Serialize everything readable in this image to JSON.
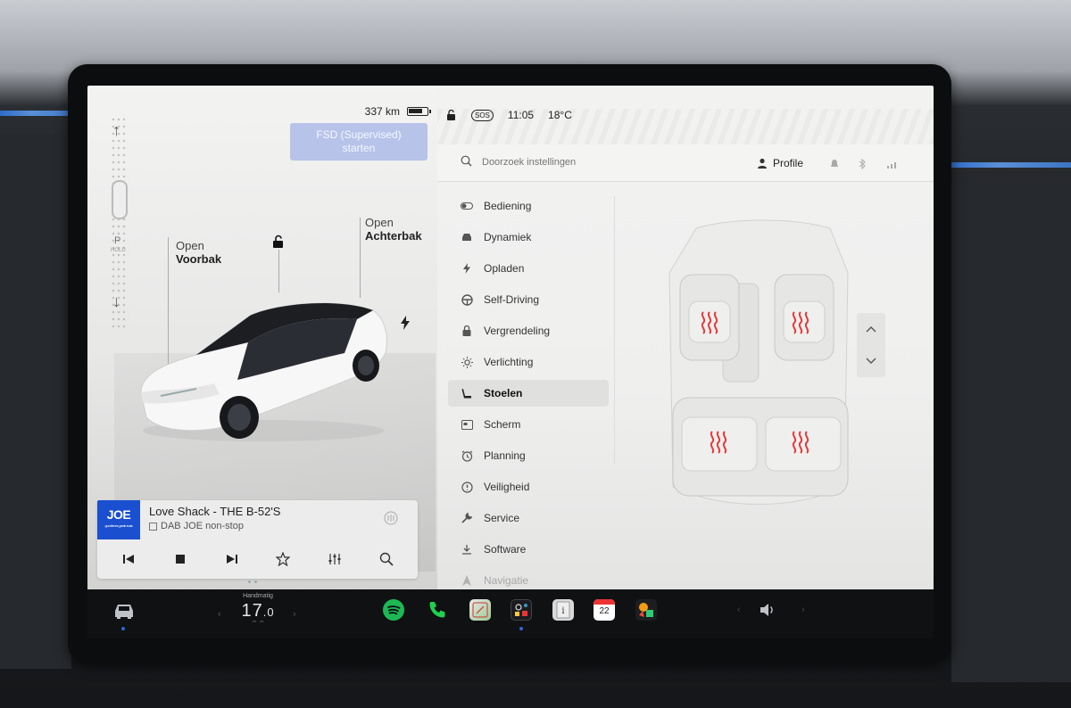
{
  "status_left": {
    "range": "337 km"
  },
  "fsd_button": {
    "line1": "FSD (Supervised)",
    "line2": "starten"
  },
  "gear": {
    "park": "P",
    "hold": "HOLD"
  },
  "car_labels": {
    "front_trunk": {
      "top": "Open",
      "bottom": "Voorbak"
    },
    "rear_trunk": {
      "top": "Open",
      "bottom": "Achterbak"
    }
  },
  "media": {
    "station_logo": "JOE",
    "station_tagline": "good times, great music",
    "title": "Love Shack - THE B-52'S",
    "subtitle": "DAB JOE non-stop"
  },
  "status_right": {
    "time": "11:05",
    "temp": "18°C",
    "sos": "SOS"
  },
  "search": {
    "placeholder": "Doorzoek instellingen"
  },
  "profile": {
    "label": "Profile"
  },
  "menu": {
    "items": [
      {
        "label": "Bediening",
        "icon": "toggle-icon"
      },
      {
        "label": "Dynamiek",
        "icon": "car-icon"
      },
      {
        "label": "Opladen",
        "icon": "bolt-icon"
      },
      {
        "label": "Self-Driving",
        "icon": "steering-wheel-icon"
      },
      {
        "label": "Vergrendeling",
        "icon": "lock-icon"
      },
      {
        "label": "Verlichting",
        "icon": "light-icon"
      },
      {
        "label": "Stoelen",
        "icon": "seat-icon",
        "active": true
      },
      {
        "label": "Scherm",
        "icon": "display-icon"
      },
      {
        "label": "Planning",
        "icon": "alarm-icon"
      },
      {
        "label": "Veiligheid",
        "icon": "shield-icon"
      },
      {
        "label": "Service",
        "icon": "wrench-icon"
      },
      {
        "label": "Software",
        "icon": "download-icon"
      },
      {
        "label": "Navigatie",
        "icon": "navigation-icon"
      }
    ]
  },
  "climate": {
    "mode": "Handmatig",
    "temp_int": "17",
    "temp_dec": ".0"
  },
  "dock_apps": [
    "spotify-icon",
    "phone-icon",
    "media-icon",
    "toybox-icon",
    "manual-icon",
    "calendar-icon",
    "games-icon"
  ],
  "calendar_day": "22",
  "colors": {
    "accent_blue": "#2f66d9",
    "fsd_button": "#b7c3e9",
    "seat_heat": "#e23b3b",
    "spotify": "#1db954",
    "phone": "#1fcf4f"
  }
}
